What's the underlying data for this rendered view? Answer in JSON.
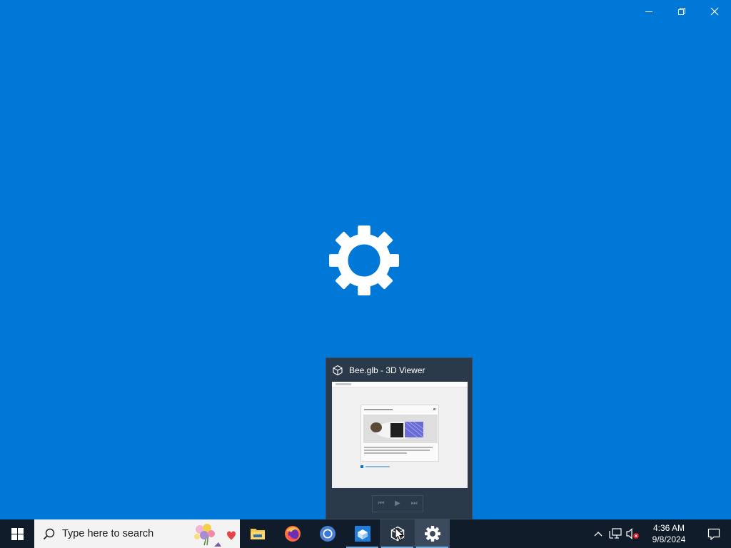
{
  "window": {
    "minimize_icon": "minimize-icon",
    "restore_icon": "restore-icon",
    "close_icon": "close-icon",
    "splash_icon": "gear-icon"
  },
  "preview": {
    "title": "Bee.glb - 3D Viewer",
    "app_icon": "cube-icon",
    "controls": [
      "⏮",
      "▶",
      "⏭"
    ]
  },
  "taskbar": {
    "start_icon": "windows-logo-icon",
    "search": {
      "placeholder": "Type here to search",
      "icon": "search-icon"
    },
    "apps": [
      {
        "name": "File Explorer",
        "icon": "folder-icon"
      },
      {
        "name": "Firefox",
        "icon": "firefox-icon"
      },
      {
        "name": "Chrome",
        "icon": "chrome-icon"
      },
      {
        "name": "Store",
        "icon": "store-icon"
      },
      {
        "name": "3D Viewer",
        "icon": "cube-icon"
      },
      {
        "name": "Settings",
        "icon": "gear-icon"
      }
    ],
    "tray": {
      "overflow_icon": "chevron-up-icon",
      "network_icon": "network-icon",
      "volume_icon": "volume-muted-icon",
      "time": "4:36 AM",
      "date": "9/8/2024",
      "notification_icon": "notification-icon"
    }
  },
  "colors": {
    "desktop": "#0078d7",
    "taskbar": "#101c2a",
    "preview": "#2b3a4a"
  }
}
